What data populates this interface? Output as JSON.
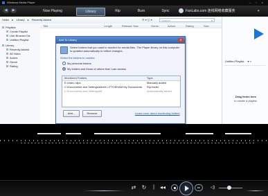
{
  "window": {
    "title": "Windows Media Player",
    "controls": "– ▫ ×"
  },
  "tabs": {
    "now_playing": "Now Playing",
    "library": "Library",
    "rip": "Rip",
    "burn": "Burn",
    "sync": "Sync",
    "account_email": "FanLabs.com  连线网络收藏服务",
    "account_caret": "▾"
  },
  "library_bar": {
    "breadcrumb": [
      "Video",
      "▸",
      "Library",
      "▸",
      "Recently Added"
    ],
    "search_placeholder": "Search",
    "view_icons": "☰ ▾  ◫ ▾"
  },
  "nav": {
    "playlists": "Playlists",
    "create_playlist": "Create Playlist",
    "like_browser_da": "Like Browser Da",
    "untitled_playlist": "Untitled Playlist",
    "library": "Library",
    "recently_added": "Recently Added",
    "all_video": "All Video",
    "actors": "Actors",
    "genre": "Genre",
    "rating": "Rating"
  },
  "columns": {
    "title": "Title",
    "length": "Length",
    "release_year": "Release Year",
    "genre": "Genre",
    "actors": "Actors",
    "rating": "Rating",
    "size": "Size"
  },
  "right_pane": {
    "playlist_title": "Untitled Playlist",
    "chevron": "▾  »",
    "drag_heading": "Drag items here",
    "drag_sub": "to create a playlist."
  },
  "dialog": {
    "title": "Add To Library",
    "close": "✕",
    "description": "Select folders that you want to monitor for media files. The Player library on this computer is updated automatically to reflect changes.",
    "select_label": "Select the folders to monitor",
    "radio_personal": "My personal folders",
    "radio_all": "My folders and those of others that I can access",
    "folders_header_monitored": "Monitored Folders",
    "folders_header_type": "Type",
    "folders": [
      {
        "path": "E:\\video clips",
        "type": "Manually added"
      },
      {
        "path": "C:\\Documents and Settings\\Albert LITTOSHAM My Documents",
        "type": "Rip folder"
      },
      {
        "path": "C:\\Documents and Settings\\All",
        "type": "Automatically added"
      }
    ],
    "add_button": "Add...",
    "remove_button": "Remove",
    "link": "Learn more about monitoring folders"
  },
  "controls": {
    "shuffle": "⇄",
    "repeat": "↻",
    "stop": "",
    "play": "",
    "next": "▸▸",
    "mute": "◁)"
  }
}
